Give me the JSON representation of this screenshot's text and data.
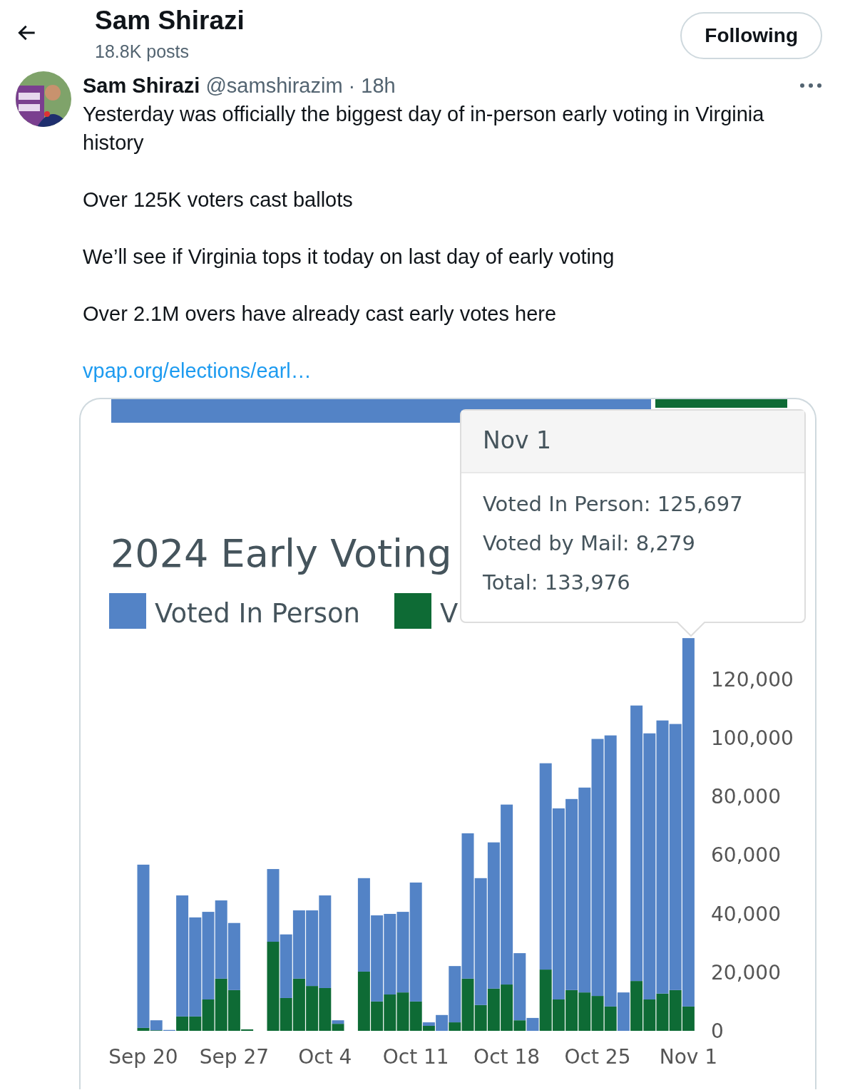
{
  "header": {
    "title": "Sam Shirazi",
    "subtitle": "18.8K posts",
    "follow_button": "Following"
  },
  "tweet": {
    "author": "Sam Shirazi",
    "handle": "@samshirazim",
    "separator": "·",
    "time": "18h",
    "paragraphs": [
      "Yesterday was officially the biggest day of in-person early voting in Virginia history",
      "Over 125K voters cast ballots",
      "We’ll see if Virginia tops it today on last day of early voting",
      "Over 2.1M overs have already cast early votes here"
    ],
    "link": "vpap.org/elections/earl…",
    "media": {
      "title": "2024 Early Voting",
      "legend_cut_label": "V",
      "tooltip": {
        "title": "Nov 1",
        "separator": ":",
        "series_values": [
          "125,697",
          "8,279"
        ],
        "total_label": "Total",
        "total_value": "133,976"
      },
      "chart_data": {
        "type": "bar",
        "stacked": true,
        "categories": [
          "Sep 20",
          null,
          null,
          null,
          null,
          null,
          null,
          "Sep 27",
          null,
          null,
          null,
          null,
          null,
          null,
          "Oct 4",
          null,
          null,
          null,
          null,
          null,
          null,
          "Oct 11",
          null,
          null,
          null,
          null,
          null,
          null,
          "Oct 18",
          null,
          null,
          null,
          null,
          null,
          null,
          "Oct 25",
          null,
          null,
          null,
          null,
          null,
          null,
          "Nov 1"
        ],
        "yticks": [
          {
            "value": 0,
            "label": "0"
          },
          {
            "value": 20000,
            "label": "20,000"
          },
          {
            "value": 40000,
            "label": "40,000"
          },
          {
            "value": 60000,
            "label": "60,000"
          },
          {
            "value": 80000,
            "label": "80,000"
          },
          {
            "value": 100000,
            "label": "100,000"
          },
          {
            "value": 120000,
            "label": "120,000"
          }
        ],
        "ylim": [
          0,
          135000
        ],
        "series": [
          {
            "name": "Voted by Mail",
            "color": "#0e6b35",
            "values": [
              1000,
              200,
              0,
              4900,
              4900,
              10700,
              17800,
              13900,
              500,
              0,
              30400,
              11200,
              17800,
              15300,
              14600,
              2400,
              0,
              20200,
              10000,
              12400,
              13100,
              10000,
              1700,
              0,
              2900,
              17800,
              8800,
              14400,
              15800,
              3600,
              0,
              20900,
              10700,
              13900,
              13100,
              11900,
              8300,
              0,
              17000,
              10700,
              12700,
              13900,
              8300
            ]
          },
          {
            "name": "Voted In Person",
            "color": "#5383c6",
            "values": [
              55700,
              3400,
              300,
              41300,
              33800,
              29900,
              26700,
              22900,
              null,
              0,
              24800,
              21700,
              23300,
              25800,
              31600,
              1200,
              0,
              31900,
              29400,
              27500,
              27500,
              40600,
              1200,
              5400,
              19200,
              49600,
              43300,
              49900,
              61400,
              22900,
              4400,
              70400,
              65200,
              65200,
              69900,
              87700,
              92500,
              13100,
              94000,
              90800,
              93200,
              90800,
              125700
            ]
          }
        ]
      }
    }
  }
}
